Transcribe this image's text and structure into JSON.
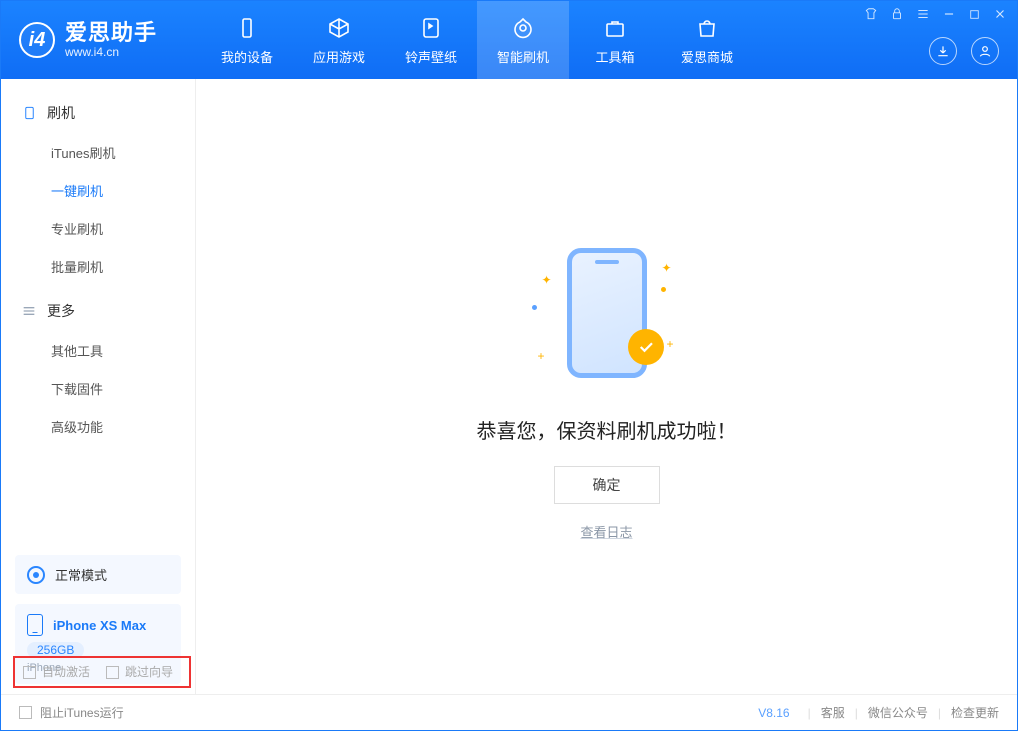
{
  "brand": {
    "name": "爱思助手",
    "sub": "www.i4.cn",
    "logo_letter": "i4"
  },
  "nav": {
    "tabs": [
      {
        "label": "我的设备"
      },
      {
        "label": "应用游戏"
      },
      {
        "label": "铃声壁纸"
      },
      {
        "label": "智能刷机"
      },
      {
        "label": "工具箱"
      },
      {
        "label": "爱思商城"
      }
    ],
    "active_index": 3
  },
  "sidebar": {
    "groups": [
      {
        "title": "刷机",
        "items": [
          "iTunes刷机",
          "一键刷机",
          "专业刷机",
          "批量刷机"
        ],
        "active_index": 1
      },
      {
        "title": "更多",
        "items": [
          "其他工具",
          "下载固件",
          "高级功能"
        ],
        "active_index": -1
      }
    ]
  },
  "mode": {
    "label": "正常模式"
  },
  "device": {
    "name": "iPhone XS Max",
    "capacity": "256GB",
    "type": "iPhone"
  },
  "low_options": {
    "opt1": "自动激活",
    "opt2": "跳过向导"
  },
  "main": {
    "success_text": "恭喜您，保资料刷机成功啦！",
    "ok_button": "确定",
    "log_link": "查看日志"
  },
  "footer": {
    "block_itunes": "阻止iTunes运行",
    "version": "V8.16",
    "links": [
      "客服",
      "微信公众号",
      "检查更新"
    ]
  }
}
